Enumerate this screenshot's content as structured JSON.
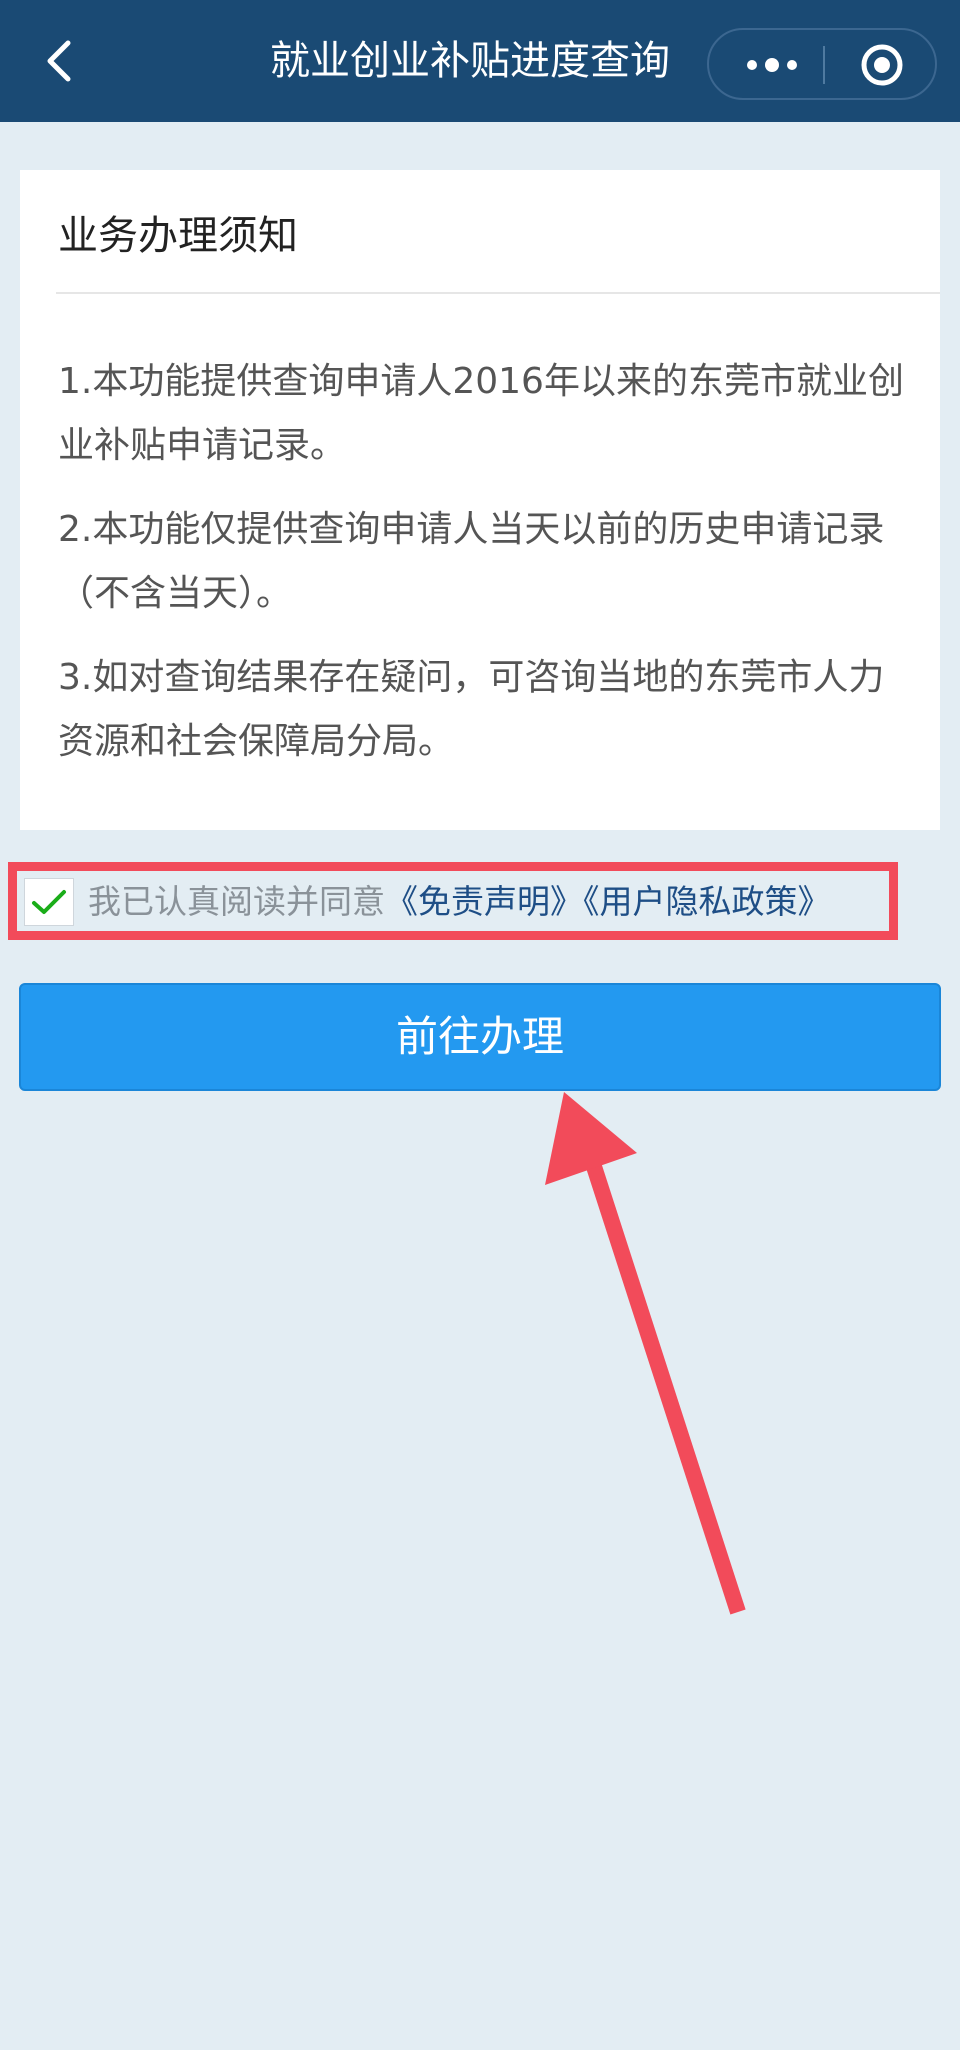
{
  "header": {
    "title": "就业创业补贴进度查询",
    "back_icon": "chevron-left-icon",
    "more_icon": "more-dots-icon",
    "close_icon": "target-circle-icon",
    "background_color": "#1a4a74"
  },
  "notice_card": {
    "title": "业务办理须知",
    "items": [
      "1.本功能提供查询申请人2016年以来的东莞市就业创业补贴申请记录。",
      "2.本功能仅提供查询申请人当天以前的历史申请记录（不含当天）。",
      "3.如对查询结果存在疑问，可咨询当地的东莞市人力资源和社会保障局分局。"
    ]
  },
  "agreement": {
    "checked": true,
    "prefix": "我已认真阅读并同意",
    "link_disclaimer": "《免责声明》",
    "link_privacy": "《用户隐私政策》",
    "check_icon": "check-icon",
    "highlight_color": "#f24b5a"
  },
  "primary_button": {
    "label": "前往办理",
    "color": "#2399f0"
  },
  "annotation": {
    "arrow_icon": "red-arrow-icon",
    "color": "#f24b5a"
  }
}
